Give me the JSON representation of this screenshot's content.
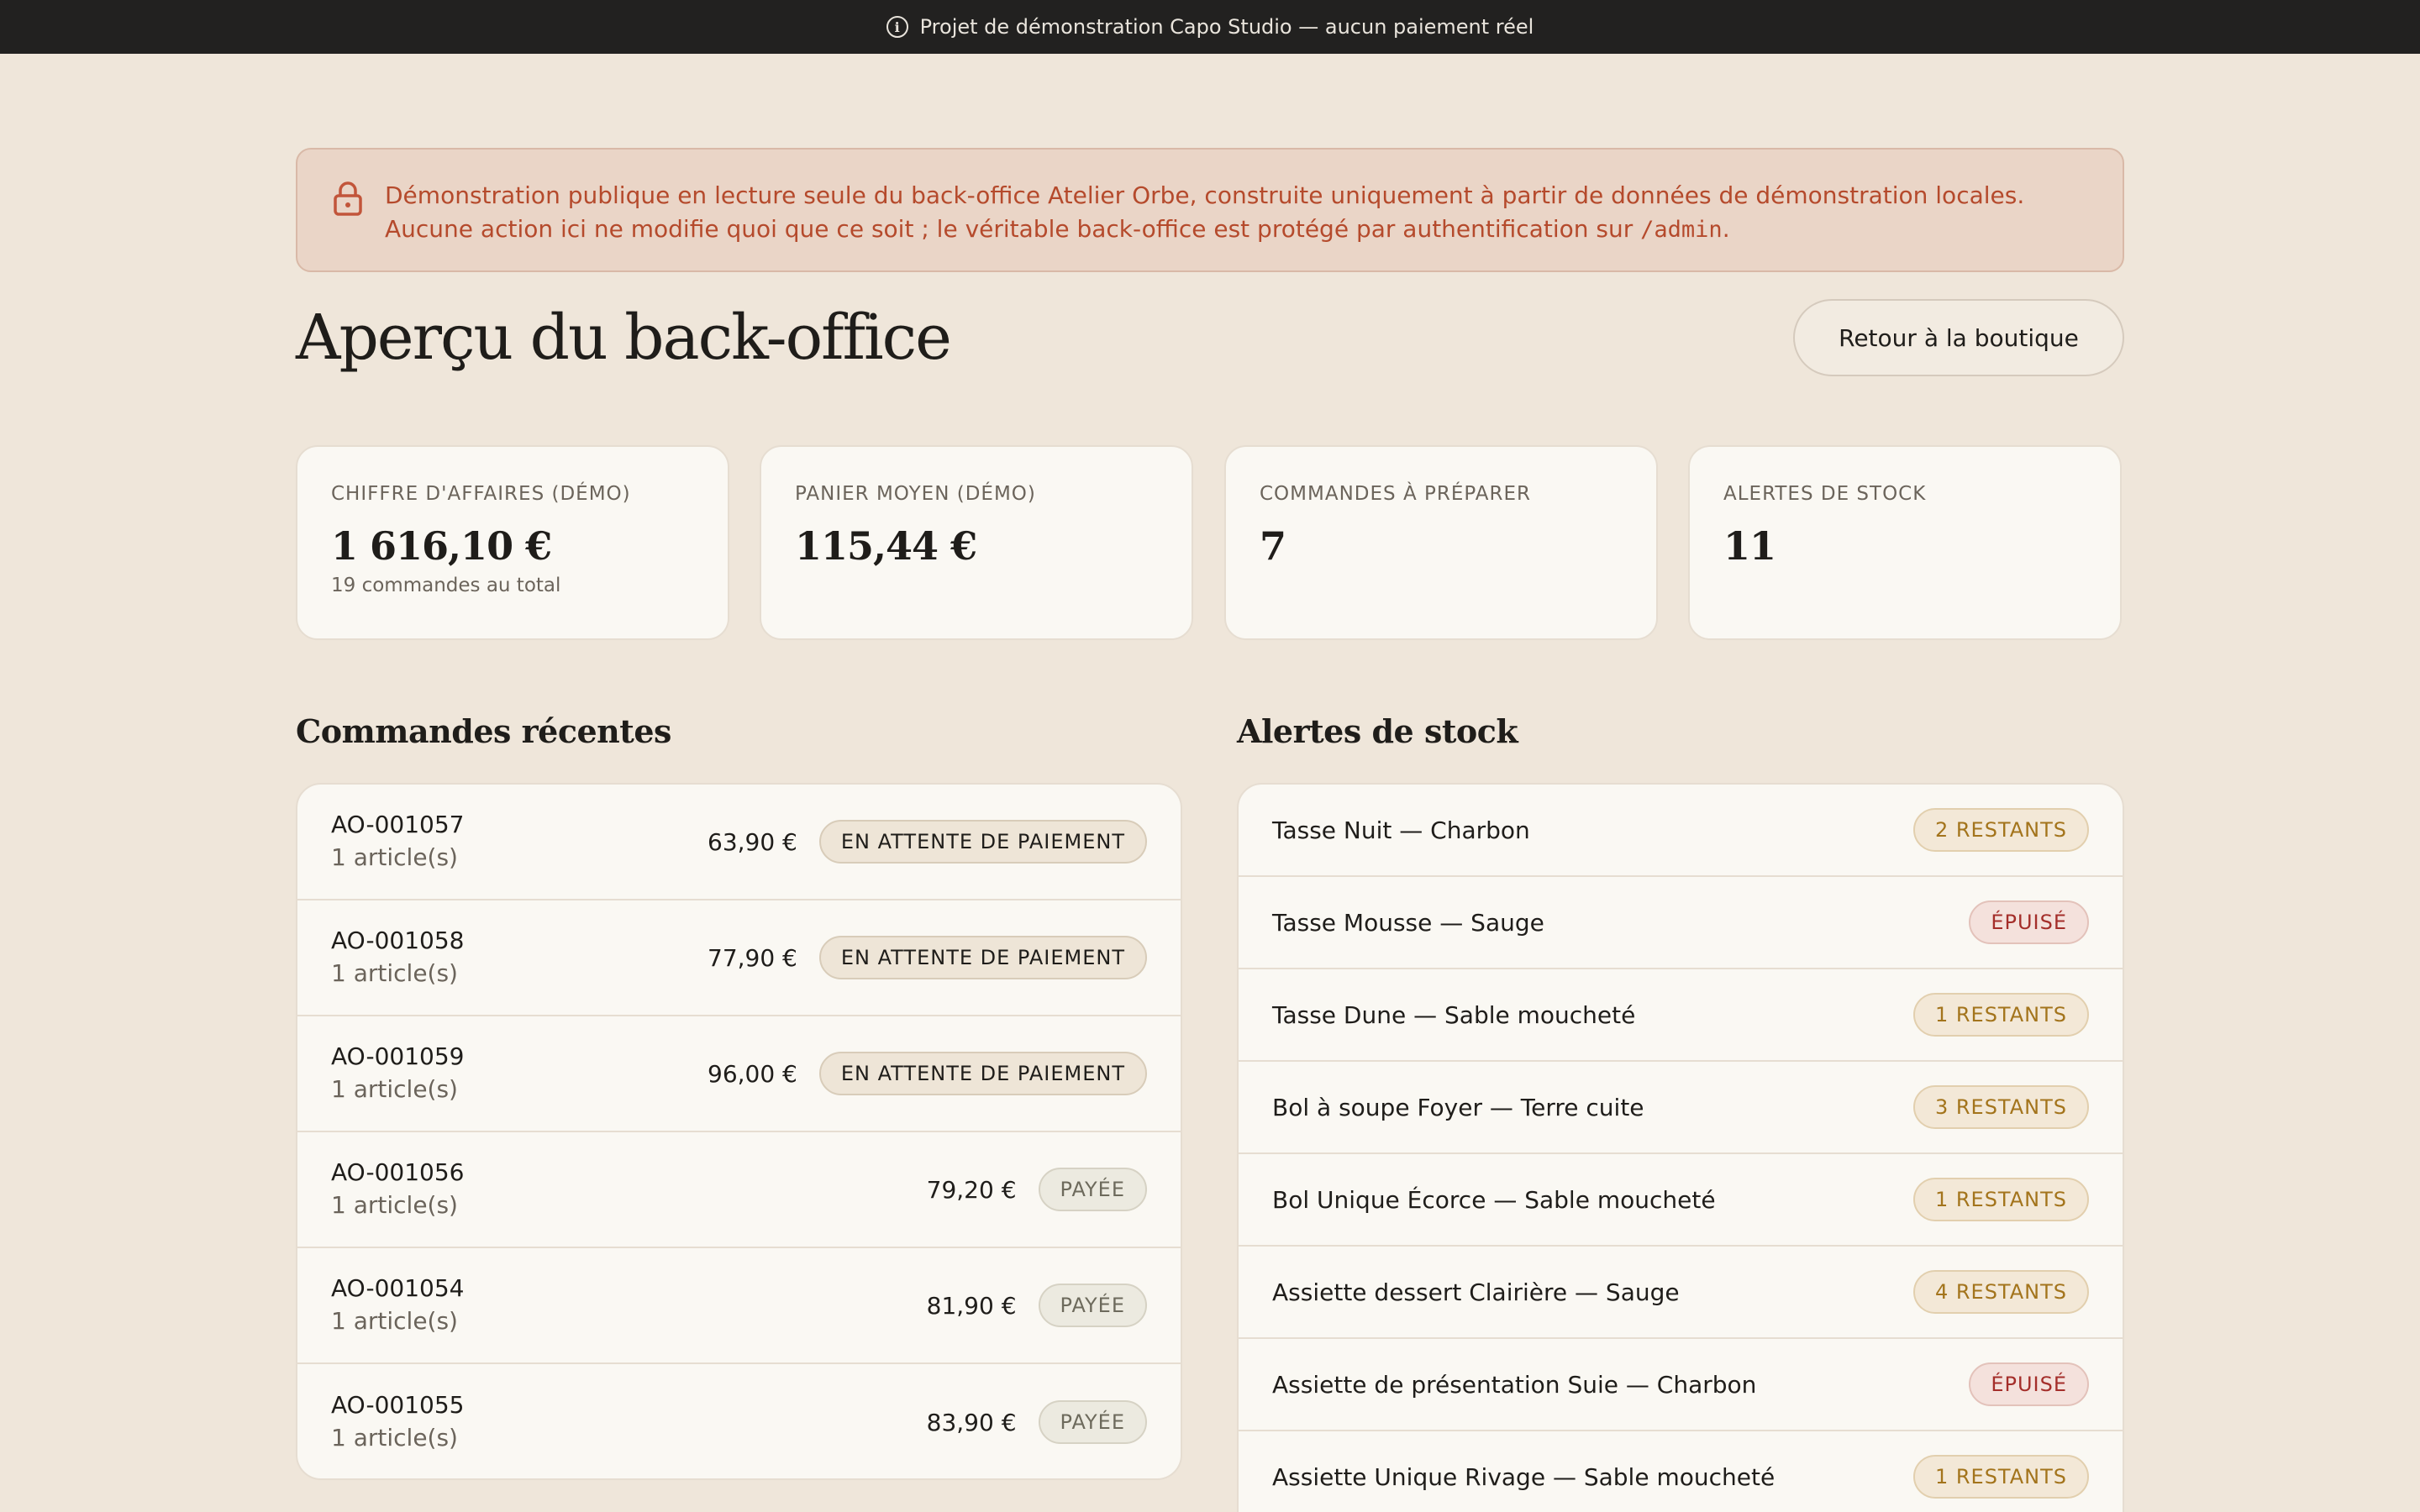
{
  "banner": {
    "text": "Projet de démonstration Capo Studio — aucun paiement réel",
    "icon": "info-icon"
  },
  "notice": {
    "icon": "lock-icon",
    "line1": "Démonstration publique en lecture seule du back-office Atelier Orbe, construite uniquement à partir de données de démonstration locales.",
    "line2_before": "Aucune action ici ne modifie quoi que ce soit ; le véritable back-office est protégé par authentification sur ",
    "line2_code": "/admin",
    "line2_after": "."
  },
  "header": {
    "title": "Aperçu du back-office",
    "back_button": "Retour à la boutique"
  },
  "kpis": [
    {
      "label": "CHIFFRE D'AFFAIRES (DÉMO)",
      "value": "1 616,10 €",
      "sub": "19 commandes au total"
    },
    {
      "label": "PANIER MOYEN (DÉMO)",
      "value": "115,44 €",
      "sub": ""
    },
    {
      "label": "COMMANDES À PRÉPARER",
      "value": "7",
      "sub": ""
    },
    {
      "label": "ALERTES DE STOCK",
      "value": "11",
      "sub": ""
    }
  ],
  "orders": {
    "title": "Commandes récentes",
    "rows": [
      {
        "id": "AO-001057",
        "items": "1 article(s)",
        "amount": "63,90 €",
        "status": "EN ATTENTE DE PAIEMENT",
        "kind": "pending"
      },
      {
        "id": "AO-001058",
        "items": "1 article(s)",
        "amount": "77,90 €",
        "status": "EN ATTENTE DE PAIEMENT",
        "kind": "pending"
      },
      {
        "id": "AO-001059",
        "items": "1 article(s)",
        "amount": "96,00 €",
        "status": "EN ATTENTE DE PAIEMENT",
        "kind": "pending"
      },
      {
        "id": "AO-001056",
        "items": "1 article(s)",
        "amount": "79,20 €",
        "status": "PAYÉE",
        "kind": "paid"
      },
      {
        "id": "AO-001054",
        "items": "1 article(s)",
        "amount": "81,90 €",
        "status": "PAYÉE",
        "kind": "paid"
      },
      {
        "id": "AO-001055",
        "items": "1 article(s)",
        "amount": "83,90 €",
        "status": "PAYÉE",
        "kind": "paid"
      }
    ]
  },
  "stock": {
    "title": "Alertes de stock",
    "rows": [
      {
        "name": "Tasse Nuit — Charbon",
        "status": "2 RESTANTS",
        "kind": "left"
      },
      {
        "name": "Tasse Mousse — Sauge",
        "status": "ÉPUISÉ",
        "kind": "out"
      },
      {
        "name": "Tasse Dune — Sable moucheté",
        "status": "1 RESTANTS",
        "kind": "left"
      },
      {
        "name": "Bol à soupe Foyer — Terre cuite",
        "status": "3 RESTANTS",
        "kind": "left"
      },
      {
        "name": "Bol Unique Écorce — Sable moucheté",
        "status": "1 RESTANTS",
        "kind": "left"
      },
      {
        "name": "Assiette dessert Clairière — Sauge",
        "status": "4 RESTANTS",
        "kind": "left"
      },
      {
        "name": "Assiette de présentation Suie — Charbon",
        "status": "ÉPUISÉ",
        "kind": "out"
      },
      {
        "name": "Assiette Unique Rivage — Sable moucheté",
        "status": "1 RESTANTS",
        "kind": "left"
      }
    ]
  },
  "colors": {
    "background": "#efe6da",
    "topbar": "#222120",
    "notice_bg": "#ead5c7",
    "notice_text": "#b54a2c",
    "card": "#faf8f3",
    "low_stock": "#a3741c",
    "out_of_stock": "#a42e2a"
  }
}
